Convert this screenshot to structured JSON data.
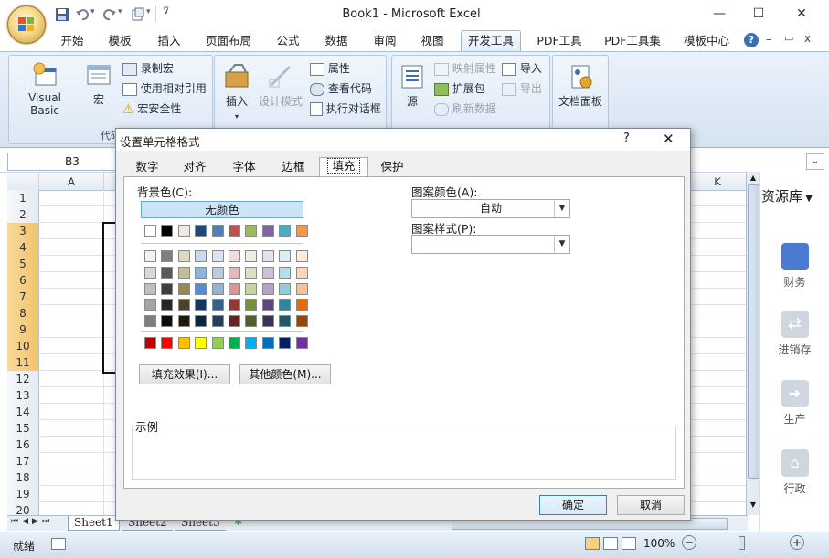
{
  "window": {
    "title": "Book1 - Microsoft Excel",
    "minimize": "—",
    "maximize": "☐",
    "close": "✕"
  },
  "ribbon_tabs": [
    "开始",
    "模板",
    "插入",
    "页面布局",
    "公式",
    "数据",
    "审阅",
    "视图",
    "开发工具",
    "PDF工具",
    "PDF工具集",
    "模板中心"
  ],
  "active_tab": "开发工具",
  "ribbon_right": {
    "help": "?",
    "min": "–",
    "restore": "▭",
    "close": "x"
  },
  "ribbon": {
    "visual_basic": "Visual Basic",
    "macro": "宏",
    "record_macro": "录制宏",
    "relative_ref": "使用相对引用",
    "macro_security": "宏安全性",
    "code_group": "代码",
    "insert": "插入",
    "design_mode": "设计模式",
    "properties": "属性",
    "view_code": "查看代码",
    "run_dialog": "执行对话框",
    "source": "源",
    "map_props": "映射属性",
    "expansion_pack": "扩展包",
    "refresh_data": "刷新数据",
    "import": "导入",
    "export": "导出",
    "doc_panel": "文档面板"
  },
  "namebox": {
    "value": "B3"
  },
  "columns": [
    "A",
    "K"
  ],
  "rows": [
    "1",
    "2",
    "3",
    "4",
    "5",
    "6",
    "7",
    "8",
    "9",
    "10",
    "11",
    "12",
    "13",
    "14",
    "15",
    "16",
    "17",
    "18",
    "19",
    "20"
  ],
  "selected_rows": [
    "3",
    "4",
    "5",
    "6",
    "7",
    "8",
    "9",
    "10",
    "11"
  ],
  "side_panel": {
    "title": "资源库",
    "items": [
      "财务",
      "进销存",
      "生产",
      "行政"
    ]
  },
  "sheet_tabs": [
    "Sheet1",
    "Sheet2",
    "Sheet3"
  ],
  "status": {
    "ready": "就绪",
    "zoom": "100%"
  },
  "dialog": {
    "title": "设置单元格格式",
    "help": "?",
    "close": "✕",
    "tabs": [
      "数字",
      "对齐",
      "字体",
      "边框",
      "填充",
      "保护"
    ],
    "active_tab": "填充",
    "bg_color_label": "背景色(C):",
    "no_color": "无颜色",
    "pattern_color_label": "图案颜色(A):",
    "pattern_color_value": "自动",
    "pattern_style_label": "图案样式(P):",
    "pattern_style_value": "",
    "fill_effects": "填充效果(I)...",
    "more_colors": "其他颜色(M)...",
    "sample_label": "示例",
    "ok": "确定",
    "cancel": "取消",
    "theme_row": [
      "#ffffff",
      "#000000",
      "#eeece1",
      "#1f497d",
      "#4f81bd",
      "#c0504d",
      "#9bbb59",
      "#8064a2",
      "#4bacc6",
      "#f79646"
    ],
    "tint_rows": [
      [
        "#f2f2f2",
        "#7f7f7f",
        "#ddd9c3",
        "#c6d9f0",
        "#dbe5f1",
        "#f2dcdb",
        "#ebf1dd",
        "#e5e0ec",
        "#dbeef3",
        "#fdeada"
      ],
      [
        "#d8d8d8",
        "#595959",
        "#c4bd97",
        "#8db3e2",
        "#b8cce4",
        "#e5b9b7",
        "#d7e3bc",
        "#ccc1d9",
        "#b7dde8",
        "#fbd5b5"
      ],
      [
        "#bfbfbf",
        "#3f3f3f",
        "#938953",
        "#548dd4",
        "#95b3d7",
        "#d99694",
        "#c3d69b",
        "#b2a2c7",
        "#92cddc",
        "#fac08f"
      ],
      [
        "#a5a5a5",
        "#262626",
        "#494429",
        "#17365d",
        "#366092",
        "#953734",
        "#76923c",
        "#5f497a",
        "#31859b",
        "#e36c09"
      ],
      [
        "#7f7f7f",
        "#0c0c0c",
        "#1d1b10",
        "#0f243e",
        "#244061",
        "#632423",
        "#4f6128",
        "#3f3151",
        "#205867",
        "#974806"
      ]
    ],
    "standard_row": [
      "#c00000",
      "#ff0000",
      "#ffc000",
      "#ffff00",
      "#92d050",
      "#00b050",
      "#00b0f0",
      "#0070c0",
      "#002060",
      "#7030a0"
    ]
  }
}
